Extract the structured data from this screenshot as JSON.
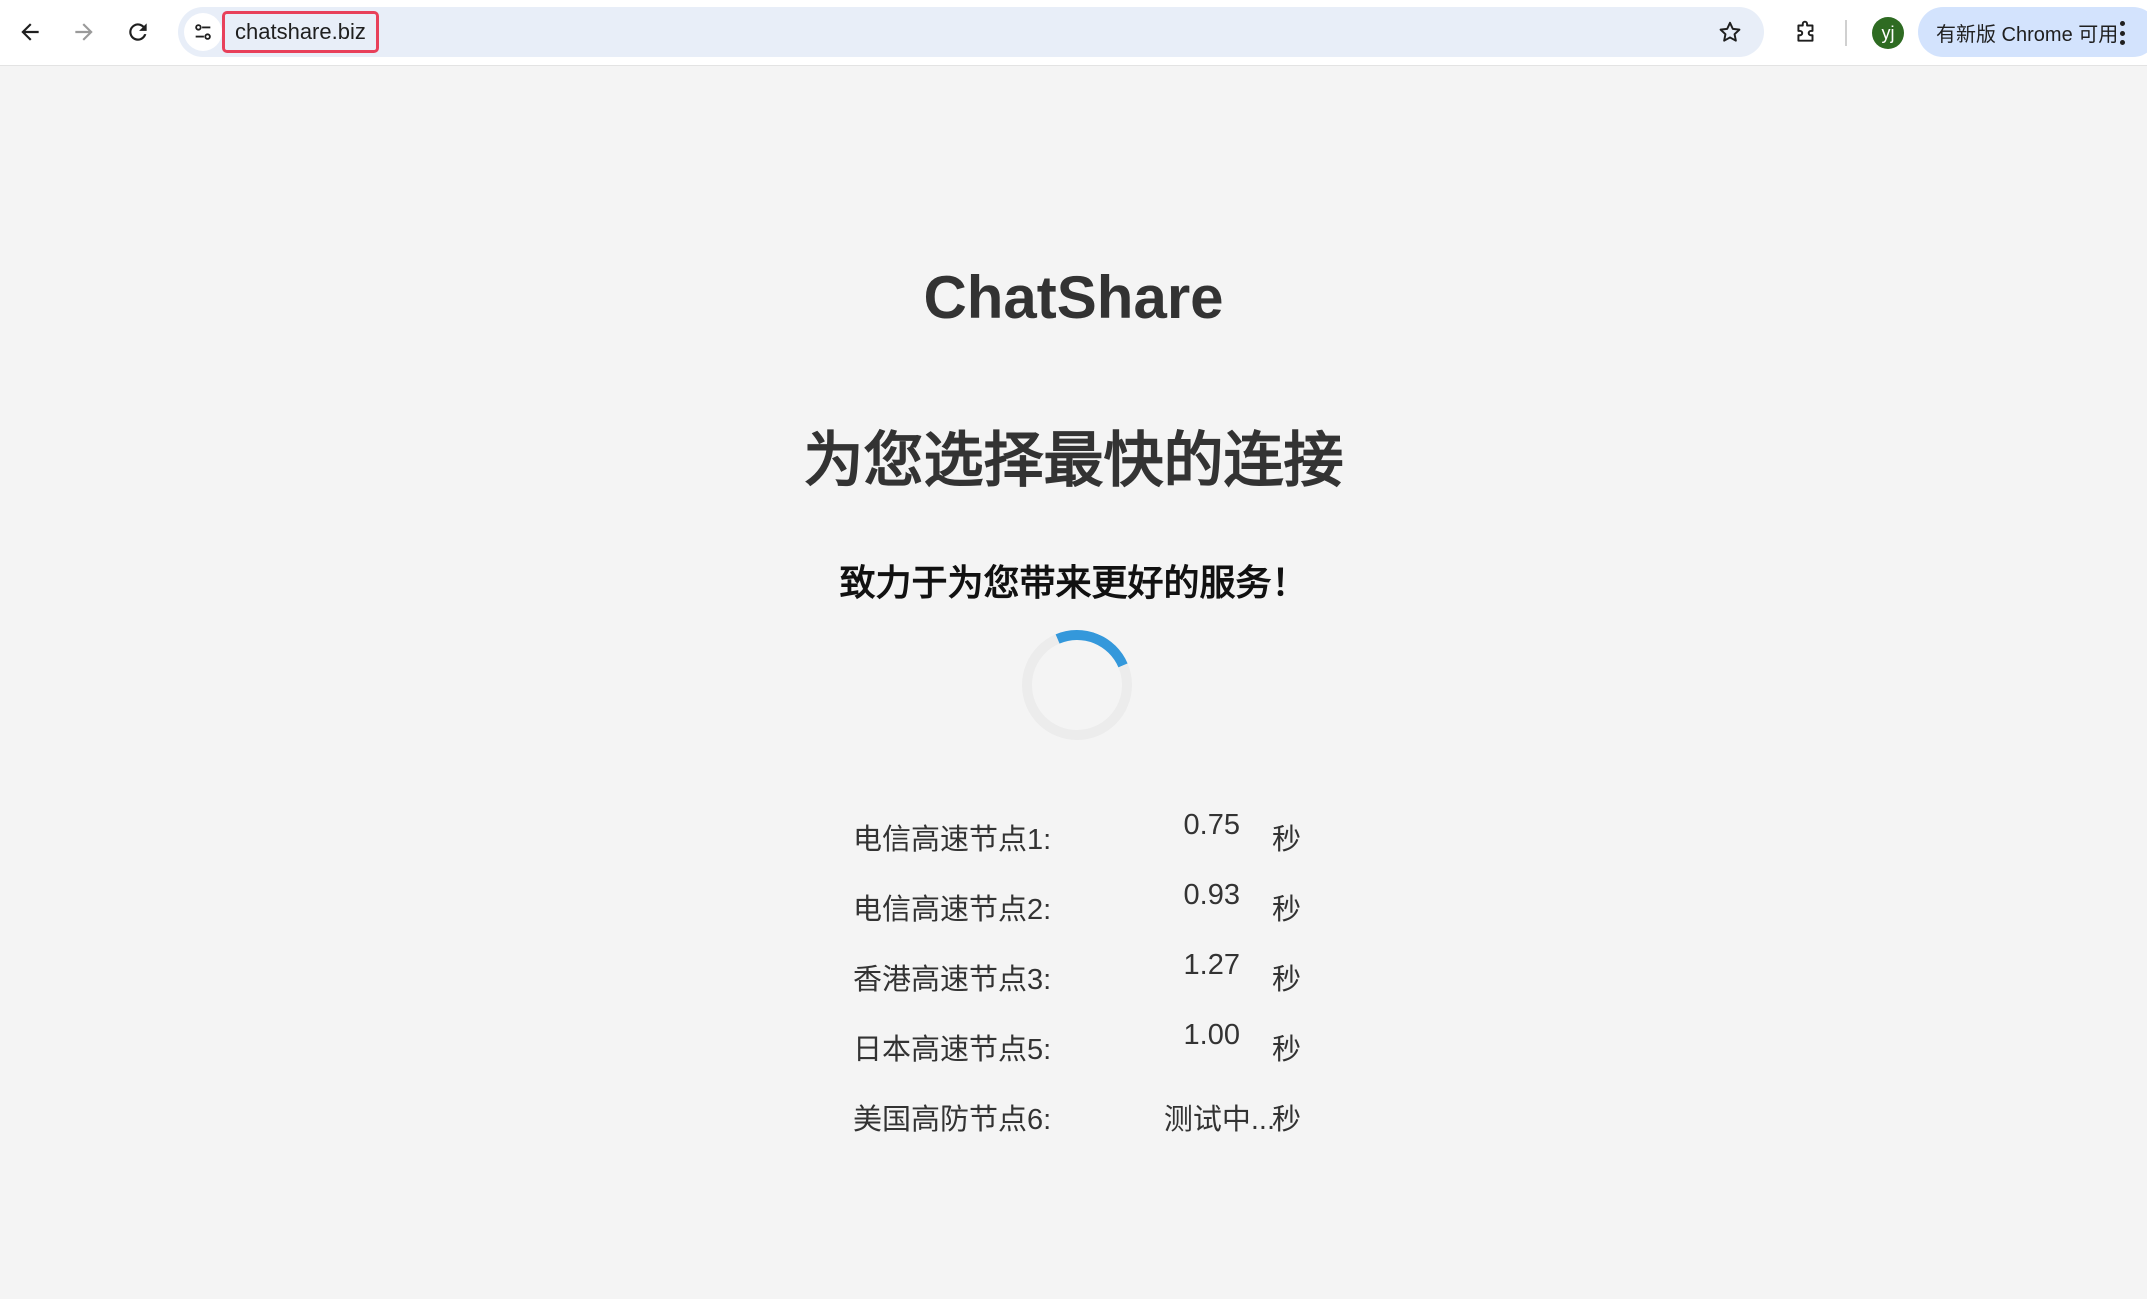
{
  "browser": {
    "url": "chatshare.biz",
    "profile_initial": "yj",
    "update_label": "有新版 Chrome 可用",
    "icons": {
      "back": "arrow-left-icon",
      "forward": "arrow-right-icon",
      "reload": "reload-icon",
      "site_info": "tune-icon",
      "bookmark": "star-icon",
      "extensions": "puzzle-icon",
      "menu": "kebab-icon"
    }
  },
  "page": {
    "brand": "ChatShare",
    "headline": "为您选择最快的连接",
    "subheadline": "致力于为您带来更好的服务！",
    "spinner_color": "#3498db",
    "nodes": [
      {
        "name": "电信高速节点1:",
        "time": "0.75",
        "unit": "秒"
      },
      {
        "name": "电信高速节点2:",
        "time": "0.93",
        "unit": "秒"
      },
      {
        "name": "香港高速节点3:",
        "time": "1.27",
        "unit": "秒"
      },
      {
        "name": "日本高速节点5:",
        "time": "1.00",
        "unit": "秒"
      },
      {
        "name": "美国高防节点6:",
        "time": "测试中...",
        "unit": "秒"
      }
    ]
  },
  "colors": {
    "highlight_border": "#e8405a",
    "omnibox_bg": "#e8eef8",
    "update_pill_bg": "#d3e3fd",
    "avatar_bg": "#2e6b22",
    "page_bg": "#f4f4f4"
  }
}
